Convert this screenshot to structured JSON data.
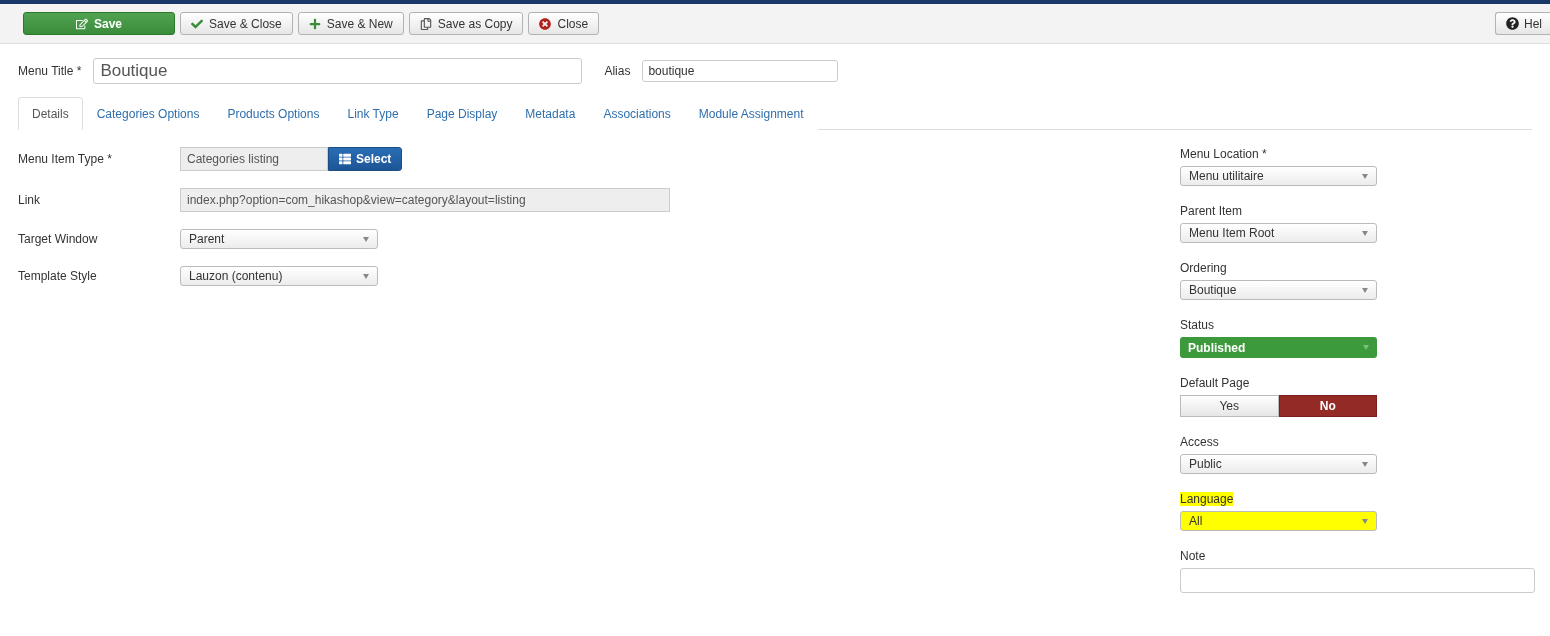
{
  "toolbar": {
    "buttons": [
      {
        "label": "Save",
        "kind": "primary"
      },
      {
        "label": "Save & Close",
        "kind": "default"
      },
      {
        "label": "Save & New",
        "kind": "default"
      },
      {
        "label": "Save as Copy",
        "kind": "default"
      },
      {
        "label": "Close",
        "kind": "default"
      }
    ],
    "help": {
      "label": "Hel"
    }
  },
  "title_row": {
    "title_label": "Menu Title *",
    "title_value": "Boutique",
    "alias_label": "Alias",
    "alias_value": "boutique"
  },
  "tabs": [
    {
      "label": "Details",
      "selected": true
    },
    {
      "label": "Categories Options",
      "selected": false
    },
    {
      "label": "Products Options",
      "selected": false
    },
    {
      "label": "Link Type",
      "selected": false
    },
    {
      "label": "Page Display",
      "selected": false
    },
    {
      "label": "Metadata",
      "selected": false
    },
    {
      "label": "Associations",
      "selected": false
    },
    {
      "label": "Module Assignment",
      "selected": false
    }
  ],
  "left_fields": [
    {
      "label": "Menu Item Type *",
      "kind": "picker",
      "value": "Categories listing",
      "button": "Select"
    },
    {
      "label": "Link",
      "kind": "readonly",
      "value": "index.php?option=com_hikashop&view=category&layout=listing"
    },
    {
      "label": "Target Window",
      "kind": "select",
      "value": "Parent"
    },
    {
      "label": "Template Style",
      "kind": "select",
      "value": "Lauzon (contenu)"
    }
  ],
  "right_fields": [
    {
      "label": "Menu Location *",
      "kind": "select",
      "value": "Menu utilitaire",
      "highlighted": false
    },
    {
      "label": "Parent Item",
      "kind": "select",
      "value": "Menu Item Root",
      "highlighted": false
    },
    {
      "label": "Ordering",
      "kind": "select",
      "value": "Boutique",
      "highlighted": false
    },
    {
      "label": "Status",
      "kind": "status",
      "value": "Published",
      "color": "#3c9a3c",
      "highlighted": false
    },
    {
      "label": "Default Page",
      "kind": "toggle",
      "options": [
        {
          "label": "Yes",
          "selected": false
        },
        {
          "label": "No",
          "selected": true
        }
      ],
      "highlighted": false
    },
    {
      "label": "Access",
      "kind": "select",
      "value": "Public",
      "highlighted": false
    },
    {
      "label": "Language",
      "kind": "select",
      "value": "All",
      "highlighted": true
    },
    {
      "label": "Note",
      "kind": "text",
      "highlighted": false
    }
  ]
}
